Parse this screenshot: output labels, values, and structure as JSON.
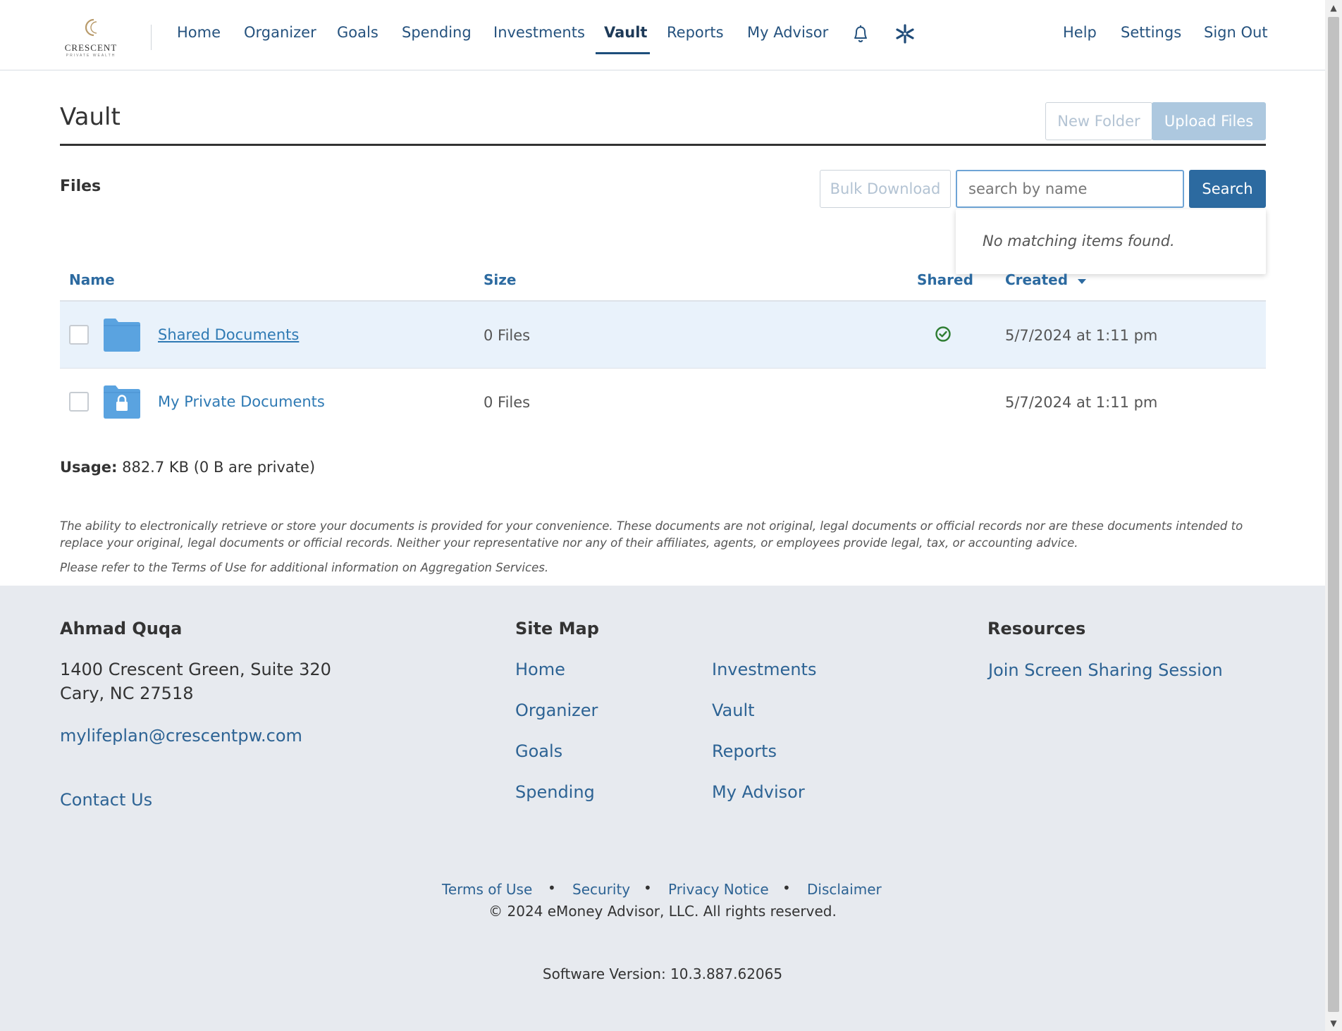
{
  "brand": {
    "name": "CRESCENT",
    "tagline": "PRIVATE WEALTH"
  },
  "nav": {
    "items": [
      "Home",
      "Organizer",
      "Goals",
      "Spending",
      "Investments",
      "Vault",
      "Reports",
      "My Advisor"
    ],
    "active": "Vault",
    "icons": [
      "bell-icon",
      "asterisk-icon"
    ],
    "right": [
      "Help",
      "Settings",
      "Sign Out"
    ]
  },
  "page": {
    "title": "Vault",
    "new_folder_label": "New Folder",
    "upload_files_label": "Upload Files"
  },
  "files": {
    "section_title": "Files",
    "bulk_download_label": "Bulk Download",
    "search": {
      "placeholder": "search by name",
      "value": "",
      "button_label": "Search",
      "no_results": "No matching items found."
    },
    "columns": {
      "name": "Name",
      "size": "Size",
      "shared": "Shared",
      "created": "Created",
      "sort": "descending"
    },
    "rows": [
      {
        "name": "Shared Documents",
        "size": "0 Files",
        "shared": true,
        "created": "5/7/2024 at 1:11 pm",
        "icon": "folder-icon"
      },
      {
        "name": "My Private Documents",
        "size": "0 Files",
        "shared": false,
        "created": "5/7/2024 at 1:11 pm",
        "icon": "locked-folder-icon"
      }
    ]
  },
  "usage": {
    "label": "Usage:",
    "value": "882.7 KB (0 B are private)"
  },
  "disclaimer": {
    "p1": "The ability to electronically retrieve or store your documents is provided for your convenience. These documents are not original, legal documents or official records nor are these documents intended to replace your original, legal documents or official records. Neither your representative nor any of their affiliates, agents, or employees provide legal, tax, or accounting advice.",
    "p2": "Please refer to the Terms of Use for additional information on Aggregation Services."
  },
  "footer": {
    "advisor": {
      "name": "Ahmad Quqa",
      "address1": "1400 Crescent Green, Suite 320",
      "address2": "Cary, NC 27518",
      "email": "mylifeplan@crescentpw.com",
      "contact": "Contact Us"
    },
    "sitemap": {
      "title": "Site Map",
      "col1": [
        "Home",
        "Organizer",
        "Goals",
        "Spending"
      ],
      "col2": [
        "Investments",
        "Vault",
        "Reports",
        "My Advisor"
      ]
    },
    "resources": {
      "title": "Resources",
      "links": [
        "Join Screen Sharing Session"
      ]
    },
    "legal": [
      "Terms of Use",
      "Security",
      "Privacy Notice",
      "Disclaimer"
    ],
    "copyright": "© 2024 eMoney Advisor, LLC. All rights reserved.",
    "version": "Software Version: 10.3.887.62065"
  },
  "colors": {
    "link": "#2c6aa0",
    "primary": "#2c6aa0",
    "row_highlight": "#e9f2fb",
    "footer_bg": "#e7eaef",
    "shared_check": "#2e7d32",
    "folder": "#5aa3e0"
  }
}
